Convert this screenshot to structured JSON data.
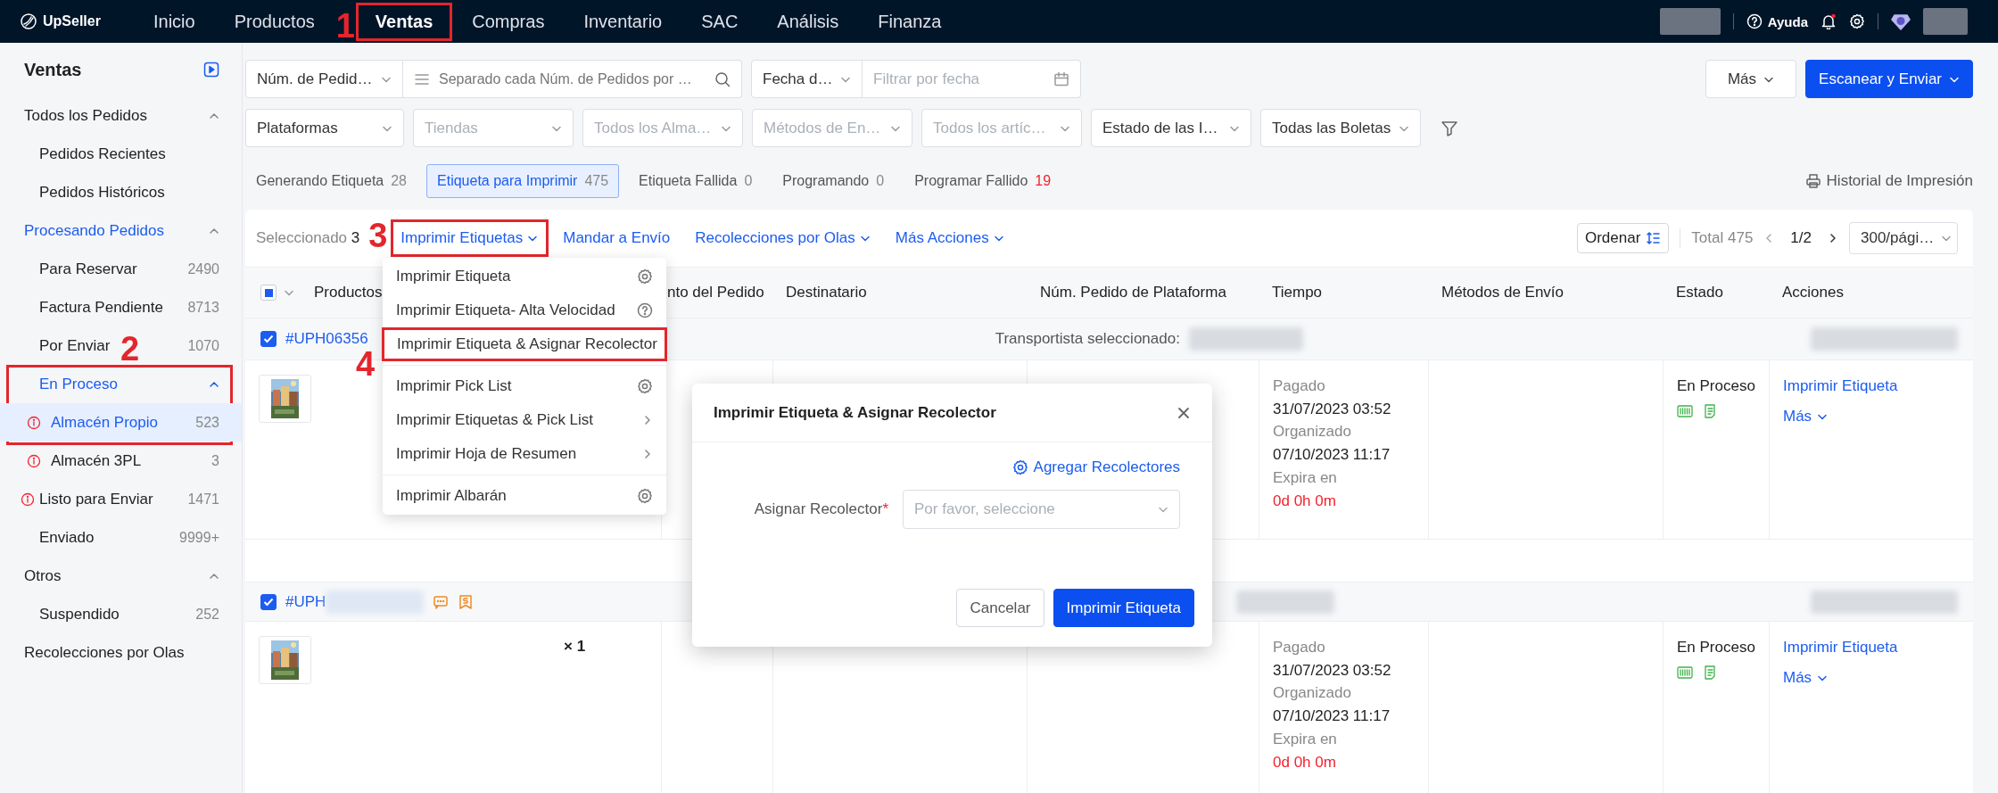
{
  "top_nav": {
    "logo": "UpSeller",
    "items": [
      {
        "label": "Inicio",
        "selected": false
      },
      {
        "label": "Productos",
        "selected": false
      },
      {
        "label": "Ventas",
        "selected": true,
        "callout": "1"
      },
      {
        "label": "Compras",
        "selected": false
      },
      {
        "label": "Inventario",
        "selected": false
      },
      {
        "label": "SAC",
        "selected": false
      },
      {
        "label": "Análisis",
        "selected": false
      },
      {
        "label": "Finanza",
        "selected": false
      }
    ],
    "help": "Ayuda"
  },
  "sidebar": {
    "title": "Ventas",
    "groups": [
      {
        "label": "Todos los Pedidos",
        "expanded": true,
        "active": false,
        "items": [
          {
            "label": "Pedidos Recientes",
            "selected": false,
            "alert": false
          },
          {
            "label": "Pedidos Históricos",
            "selected": false,
            "alert": false
          }
        ]
      },
      {
        "label": "Procesando Pedidos",
        "expanded": true,
        "active": true,
        "items": [
          {
            "label": "Para Reservar",
            "count": "2490",
            "selected": false,
            "alert": false
          },
          {
            "label": "Factura Pendiente",
            "count": "8713",
            "selected": false,
            "alert": false
          },
          {
            "label": "Por Enviar",
            "count": "1070",
            "selected": false,
            "alert": false
          },
          {
            "label": "En Proceso",
            "kind": "subgroup",
            "expanded": true,
            "active": true,
            "callout": "2",
            "children": [
              {
                "label": "Almacén Propio",
                "count": "523",
                "selected": true,
                "alert": true
              },
              {
                "label": "Almacén 3PL",
                "count": "3",
                "selected": false,
                "alert": true
              }
            ]
          },
          {
            "label": "Listo para Enviar",
            "count": "1471",
            "selected": false,
            "alert": true
          },
          {
            "label": "Enviado",
            "count": "9999+",
            "selected": false,
            "alert": false
          }
        ]
      },
      {
        "label": "Otros",
        "expanded": true,
        "active": false,
        "items": [
          {
            "label": "Suspendido",
            "count": "252",
            "selected": false,
            "alert": false
          }
        ]
      },
      {
        "label": "Recolecciones por Olas",
        "active": false
      }
    ]
  },
  "filters": {
    "order_search": {
      "field": "Núm. de Pedid…",
      "placeholder": "Separado cada Núm. de Pedidos por …"
    },
    "date_filter": {
      "field": "Fecha d…",
      "placeholder": "Filtrar por fecha"
    },
    "selects": [
      {
        "value": "Plataformas"
      },
      {
        "placeholder": "Tiendas"
      },
      {
        "placeholder": "Todos los Alma…"
      },
      {
        "placeholder": "Métodos de En…"
      },
      {
        "placeholder": "Todos los artíc…"
      },
      {
        "value": "Estado de las I…"
      },
      {
        "value": "Todas las Boletas"
      }
    ],
    "buttons": [
      {
        "label": "Más",
        "kind": "outline"
      },
      {
        "label": "Escanear y Enviar",
        "kind": "primary"
      }
    ]
  },
  "status_tabs": [
    {
      "label": "Generando Etiqueta",
      "count": "28",
      "selected": false,
      "alert": false
    },
    {
      "label": "Etiqueta para Imprimir",
      "count": "475",
      "selected": true,
      "alert": false
    },
    {
      "label": "Etiqueta Fallida",
      "count": "0",
      "selected": false,
      "alert": false
    },
    {
      "label": "Programando",
      "count": "0",
      "selected": false,
      "alert": false
    },
    {
      "label": "Programar Fallido",
      "count": "19",
      "selected": false,
      "alert": true
    }
  ],
  "print_history": "Historial de Impresión",
  "orders": {
    "selected_label": "Seleccionado",
    "selected_count": "3",
    "actions": [
      {
        "label": "Imprimir Etiquetas",
        "dropdown": true,
        "callout": "3"
      },
      {
        "label": "Mandar a Envío",
        "dropdown": false
      },
      {
        "label": "Recolecciones por Olas",
        "dropdown": true
      },
      {
        "label": "Más Acciones",
        "dropdown": true
      }
    ],
    "sort": "Ordenar",
    "total": "Total 475",
    "page": "1/2",
    "page_size": "300/pági…",
    "select_all": {
      "indeterminate": true
    },
    "columns": [
      "Productos",
      "nto del Pedido",
      "Destinatario",
      "Núm. Pedido de Plataforma",
      "Tiempo",
      "Métodos de Envío",
      "Estado",
      "Acciones"
    ],
    "groups": [
      {
        "order_no": "#UPH06356",
        "checked": true,
        "carrier_label": "Transportista seleccionado:",
        "times": [
          {
            "label": "Pagado",
            "value": "31/07/2023 03:52",
            "overdue": false
          },
          {
            "label": "Organizado",
            "value": "07/10/2023 11:17",
            "overdue": false
          },
          {
            "label": "Expira en",
            "value": "0d 0h 0m",
            "overdue": true
          }
        ],
        "status": "En Proceso",
        "actions": [
          "Imprimir Etiqueta",
          "Más"
        ]
      },
      {
        "order_no": "#UPH",
        "checked": true,
        "flags": [
          {
            "kind": "chat"
          },
          {
            "kind": "invoice"
          }
        ],
        "quantity": "× 1",
        "times": [
          {
            "label": "Pagado",
            "value": "31/07/2023 03:52",
            "overdue": false
          },
          {
            "label": "Organizado",
            "value": "07/10/2023 11:17",
            "overdue": false
          },
          {
            "label": "Expira en",
            "value": "0d 0h 0m",
            "overdue": true
          }
        ],
        "status": "En Proceso",
        "actions": [
          "Imprimir Etiqueta",
          "Más"
        ]
      }
    ]
  },
  "print_menu": {
    "sections": [
      [
        {
          "label": "Imprimir Etiqueta",
          "kind": "settings"
        },
        {
          "label": "Imprimir Etiqueta- Alta Velocidad",
          "kind": "help"
        },
        {
          "label": "Imprimir Etiqueta & Asignar Recolector",
          "kind": "plain",
          "callout": "4"
        }
      ],
      [
        {
          "label": "Imprimir Pick List",
          "kind": "settings"
        },
        {
          "label": "Imprimir Etiquetas & Pick List",
          "kind": "submenu"
        },
        {
          "label": "Imprimir Hoja de Resumen",
          "kind": "submenu"
        }
      ],
      [
        {
          "label": "Imprimir Albarán",
          "kind": "settings"
        }
      ]
    ]
  },
  "modal": {
    "title": "Imprimir Etiqueta & Asignar Recolector",
    "link": "Agregar Recolectores",
    "field_label": "Asignar Recolector",
    "required_mark": "*",
    "placeholder": "Por favor, seleccione",
    "buttons": [
      {
        "label": "Cancelar",
        "kind": "default"
      },
      {
        "label": "Imprimir Etiqueta",
        "kind": "primary"
      }
    ]
  }
}
